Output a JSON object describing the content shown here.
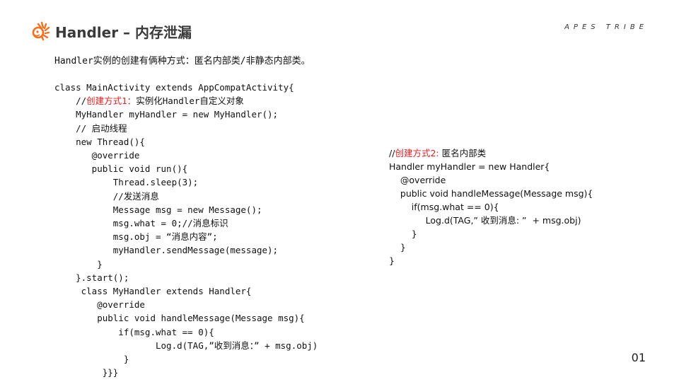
{
  "header": {
    "logo_icon": "lion-head-logo",
    "title": "Handler – 内存泄漏",
    "brand": "APES TRIBE",
    "accent_color": "#f07020"
  },
  "intro": "Handler实例的创建有俩种方式：匿名内部类/非静态内部类。",
  "code_left": {
    "lines": [
      {
        "indent": "",
        "pre": "class MainActivity extends AppCompatActivity{",
        "red": "",
        "post": ""
      },
      {
        "indent": "    ",
        "pre": "//",
        "red": "创建方式1：",
        "post": "实例化Handler自定义对象"
      },
      {
        "indent": "    ",
        "pre": "MyHandler myHandler = new MyHandler();",
        "red": "",
        "post": ""
      },
      {
        "indent": "    ",
        "pre": "// 启动线程",
        "red": "",
        "post": ""
      },
      {
        "indent": "    ",
        "pre": "new Thread(){",
        "red": "",
        "post": ""
      },
      {
        "indent": "       ",
        "pre": "@override",
        "red": "",
        "post": ""
      },
      {
        "indent": "       ",
        "pre": "public void run(){",
        "red": "",
        "post": ""
      },
      {
        "indent": "           ",
        "pre": "Thread.sleep(3);",
        "red": "",
        "post": ""
      },
      {
        "indent": "           ",
        "pre": "//发送消息",
        "red": "",
        "post": ""
      },
      {
        "indent": "           ",
        "pre": "Message msg = new Message();",
        "red": "",
        "post": ""
      },
      {
        "indent": "           ",
        "pre": "msg.what = 0;//消息标识",
        "red": "",
        "post": ""
      },
      {
        "indent": "           ",
        "pre": "msg.obj = “消息内容”;",
        "red": "",
        "post": ""
      },
      {
        "indent": "           ",
        "pre": "myHandler.sendMessage(message);",
        "red": "",
        "post": ""
      },
      {
        "indent": "        ",
        "pre": "}",
        "red": "",
        "post": ""
      },
      {
        "indent": "    ",
        "pre": "}.start();",
        "red": "",
        "post": ""
      },
      {
        "indent": "     ",
        "pre": "class MyHandler extends Handler{",
        "red": "",
        "post": ""
      },
      {
        "indent": "        ",
        "pre": "@override",
        "red": "",
        "post": ""
      },
      {
        "indent": "        ",
        "pre": "public void handleMessage(Message msg){",
        "red": "",
        "post": ""
      },
      {
        "indent": "            ",
        "pre": "if(msg.what == 0){",
        "red": "",
        "post": ""
      },
      {
        "indent": "                   ",
        "pre": "Log.d(TAG,”收到消息：” + msg.obj)",
        "red": "",
        "post": ""
      },
      {
        "indent": "             ",
        "pre": "}",
        "red": "",
        "post": ""
      },
      {
        "indent": "         ",
        "pre": "}}}",
        "red": "",
        "post": ""
      }
    ]
  },
  "code_right": {
    "lines": [
      {
        "indent": "",
        "pre": "//",
        "red": "创建方式2:",
        "post": " 匿名内部类"
      },
      {
        "indent": "",
        "pre": "Handler myHandler = new Handler{",
        "red": "",
        "post": ""
      },
      {
        "indent": "    ",
        "pre": "@override",
        "red": "",
        "post": ""
      },
      {
        "indent": "    ",
        "pre": "public void handleMessage(Message msg){",
        "red": "",
        "post": ""
      },
      {
        "indent": "        ",
        "pre": "if(msg.what == 0){",
        "red": "",
        "post": ""
      },
      {
        "indent": "             ",
        "pre": "Log.d(TAG,” 收到消息: ”  + msg.obj)",
        "red": "",
        "post": ""
      },
      {
        "indent": "        ",
        "pre": "}",
        "red": "",
        "post": ""
      },
      {
        "indent": "    ",
        "pre": "}",
        "red": "",
        "post": ""
      },
      {
        "indent": "",
        "pre": "}",
        "red": "",
        "post": ""
      }
    ]
  },
  "page_number": "01"
}
